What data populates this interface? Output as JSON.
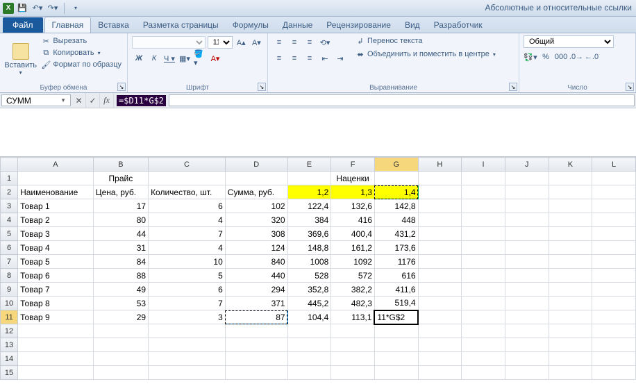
{
  "title": "Абсолютные и относительные ссылки",
  "qat": {
    "excel": "X"
  },
  "tabs": {
    "file": "Файл",
    "items": [
      "Главная",
      "Вставка",
      "Разметка страницы",
      "Формулы",
      "Данные",
      "Рецензирование",
      "Вид",
      "Разработчик"
    ],
    "activeIndex": 0
  },
  "ribbon": {
    "clipboard": {
      "paste": "Вставить",
      "cut": "Вырезать",
      "copy": "Копировать",
      "painter": "Формат по образцу",
      "title": "Буфер обмена"
    },
    "font": {
      "sizeValue": "11",
      "title": "Шрифт"
    },
    "align": {
      "wrap": "Перенос текста",
      "merge": "Объединить и поместить в центре",
      "title": "Выравнивание"
    },
    "number": {
      "format": "Общий",
      "title": "Число"
    }
  },
  "formulaBar": {
    "nameBox": "СУММ",
    "formula": "=$D11*G$2"
  },
  "chart_data": {
    "type": "table",
    "colHeaders": [
      "A",
      "B",
      "C",
      "D",
      "E",
      "F",
      "G",
      "H",
      "I",
      "J",
      "K",
      "L"
    ],
    "row1": {
      "priceTitle": "Прайс",
      "markupTitle": "Наценки"
    },
    "row2": {
      "A": "Наименование",
      "B": "Цена, руб.",
      "C": "Количество, шт.",
      "D": "Сумма, руб.",
      "E": "1,2",
      "F": "1,3",
      "G": "1,4"
    },
    "rows": [
      {
        "n": 3,
        "A": "Товар 1",
        "B": "17",
        "C": "6",
        "D": "102",
        "E": "122,4",
        "F": "132,6",
        "G": "142,8"
      },
      {
        "n": 4,
        "A": "Товар 2",
        "B": "80",
        "C": "4",
        "D": "320",
        "E": "384",
        "F": "416",
        "G": "448"
      },
      {
        "n": 5,
        "A": "Товар 3",
        "B": "44",
        "C": "7",
        "D": "308",
        "E": "369,6",
        "F": "400,4",
        "G": "431,2"
      },
      {
        "n": 6,
        "A": "Товар 4",
        "B": "31",
        "C": "4",
        "D": "124",
        "E": "148,8",
        "F": "161,2",
        "G": "173,6"
      },
      {
        "n": 7,
        "A": "Товар 5",
        "B": "84",
        "C": "10",
        "D": "840",
        "E": "1008",
        "F": "1092",
        "G": "1176"
      },
      {
        "n": 8,
        "A": "Товар 6",
        "B": "88",
        "C": "5",
        "D": "440",
        "E": "528",
        "F": "572",
        "G": "616"
      },
      {
        "n": 9,
        "A": "Товар 7",
        "B": "49",
        "C": "6",
        "D": "294",
        "E": "352,8",
        "F": "382,2",
        "G": "411,6"
      },
      {
        "n": 10,
        "A": "Товар 8",
        "B": "53",
        "C": "7",
        "D": "371",
        "E": "445,2",
        "F": "482,3",
        "G": "519,4"
      },
      {
        "n": 11,
        "A": "Товар 9",
        "B": "29",
        "C": "3",
        "D": "87",
        "E": "104,4",
        "F": "113,1",
        "G": "11*G$2"
      }
    ],
    "activeCell": "G11",
    "referencedCells": [
      "D11",
      "G2"
    ]
  }
}
